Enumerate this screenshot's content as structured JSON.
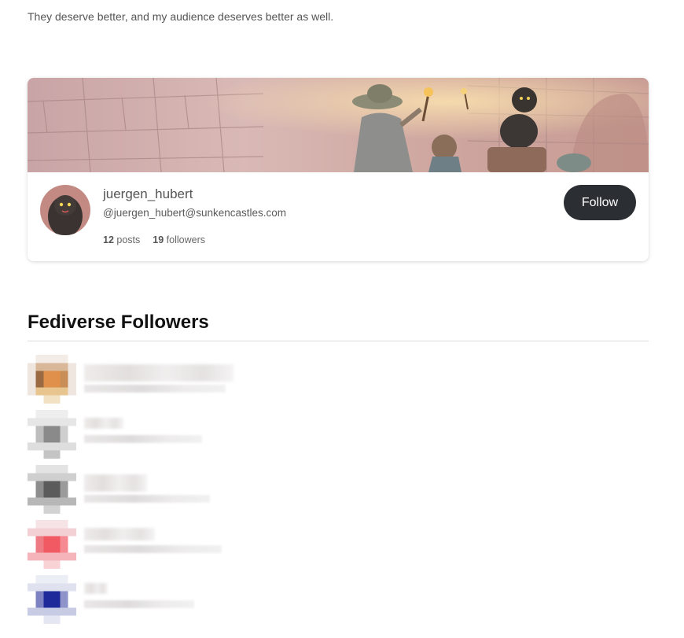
{
  "intro_text": "They deserve better, and my audience deserves better as well.",
  "profile": {
    "name": "juergen_hubert",
    "handle": "@juergen_hubert@sunkencastles.com",
    "posts_count": "12",
    "posts_label": "posts",
    "followers_count": "19",
    "followers_label": "followers",
    "follow_label": "Follow"
  },
  "followers_section": {
    "title": "Fediverse Followers",
    "items": [
      {
        "avatar_color": "#d9924a"
      },
      {
        "avatar_color": "#9a9a9a"
      },
      {
        "avatar_color": "#6e6e6e"
      },
      {
        "avatar_color": "#f0606a"
      },
      {
        "avatar_color": "#1f2a9a"
      }
    ]
  },
  "colors": {
    "follow_button_bg": "#2b2f33",
    "text_muted": "#555555"
  }
}
